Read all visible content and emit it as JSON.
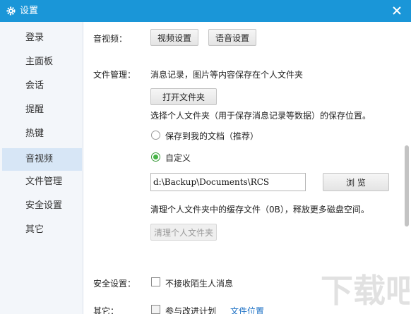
{
  "window": {
    "title": "设置",
    "icon": "gear-icon"
  },
  "sidebar": {
    "items": [
      {
        "label": "登录"
      },
      {
        "label": "主面板"
      },
      {
        "label": "会话"
      },
      {
        "label": "提醒"
      },
      {
        "label": "热键"
      },
      {
        "label": "音视频",
        "active": true
      },
      {
        "label": "文件管理"
      },
      {
        "label": "安全设置"
      },
      {
        "label": "其它"
      }
    ]
  },
  "av": {
    "label": "音视频：",
    "video_button": "视频设置",
    "audio_button": "语音设置"
  },
  "file": {
    "label": "文件管理：",
    "desc": "消息记录，图片等内容保存在个人文件夹",
    "open_button": "打开文件夹",
    "choose_text": "选择个人文件夹（用于保存消息记录等数据）的保存位置。",
    "option_docs": "保存到我的文档（推荐）",
    "option_custom": "自定义",
    "selected": "custom",
    "path_value": "d:\\Backup\\Documents\\RCS",
    "browse_button": "浏 览",
    "cache_text": "清理个人文件夹中的缓存文件（0B），释放更多磁盘空间。",
    "clean_button": "清理个人文件夹"
  },
  "security": {
    "label": "安全设置：",
    "block_strangers": "不接收陌生人消息"
  },
  "other": {
    "label": "其它：",
    "join_program": "参与改进计划",
    "file_location": "文件位置"
  },
  "watermark": {
    "text": "下载吧"
  },
  "colors": {
    "titlebar": "#1a96d8",
    "sidebar_bg": "#f3f6fa",
    "sidebar_active": "#d7e6f6",
    "radio_checked": "#45b445",
    "link": "#1a6fc4"
  }
}
